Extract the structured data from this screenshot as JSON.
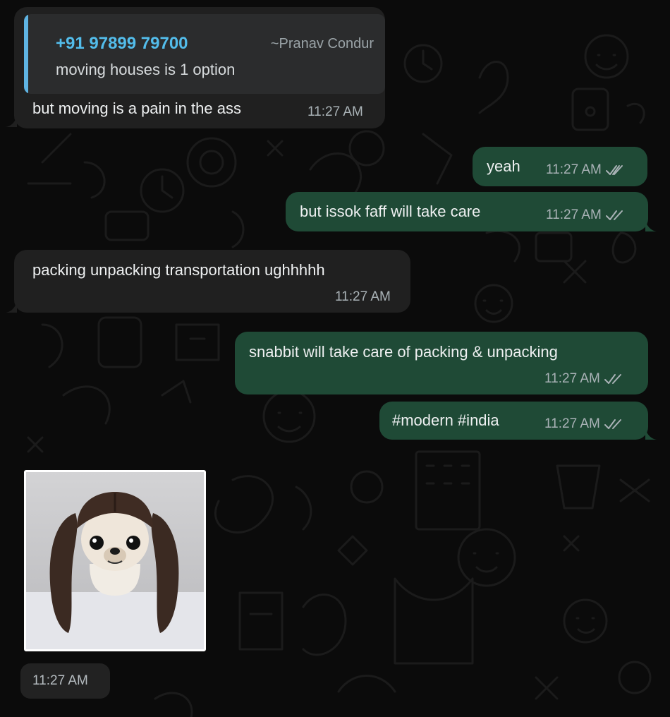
{
  "quoted": {
    "phone": "+91 97899 79700",
    "author": "~Pranav Condur",
    "text": "moving houses is 1 option"
  },
  "messages": [
    {
      "direction": "in",
      "text": "but moving is a pain in the ass",
      "time": "11:27 AM"
    },
    {
      "direction": "out",
      "text": "yeah",
      "time": "11:27 AM",
      "status": "read"
    },
    {
      "direction": "out",
      "text": "but issok faff will take care",
      "time": "11:27 AM",
      "status": "read"
    },
    {
      "direction": "in",
      "text": "packing unpacking transportation ughhhhh",
      "time": "11:27 AM"
    },
    {
      "direction": "out",
      "text": "snabbit will take care of packing & unpacking",
      "time": "11:27 AM",
      "status": "read"
    },
    {
      "direction": "out",
      "text": "#modern #india",
      "time": "11:27 AM",
      "status": "read"
    }
  ],
  "sticker": {
    "time": "11:27 AM"
  },
  "colors": {
    "incoming_bubble": "#202020",
    "outgoing_bubble": "#1f4a36",
    "quote_accent": "#53bdeb",
    "background": "#0b0b0b"
  }
}
